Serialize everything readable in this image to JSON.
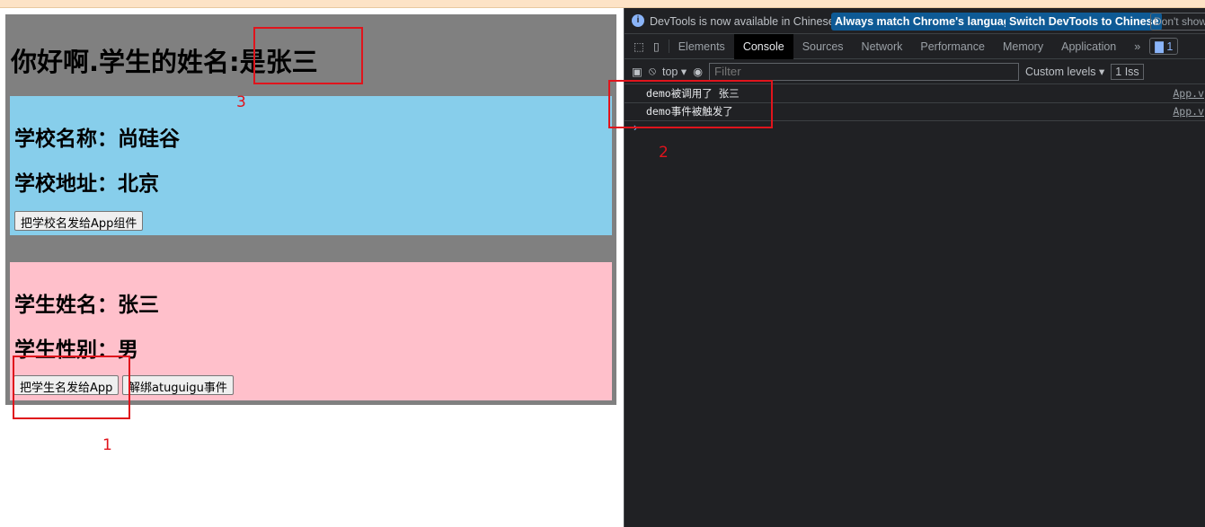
{
  "app": {
    "title": "你好啊.学生的姓名:是张三"
  },
  "school": {
    "name": "学校名称：尚硅谷",
    "address": "学校地址：北京",
    "button": "把学校名发给App组件"
  },
  "student": {
    "name": "学生姓名：张三",
    "gender": "学生性别：男",
    "send_button": "把学生名发给App",
    "unbind_button": "解绑atuguigu事件"
  },
  "annotations": [
    "1",
    "2",
    "3"
  ],
  "devtools": {
    "info": {
      "message": "DevTools is now available in Chinese!",
      "btn1": "Always match Chrome's language",
      "btn2": "Switch DevTools to Chinese",
      "btn3": "Don't show"
    },
    "tabs": [
      "Elements",
      "Console",
      "Sources",
      "Network",
      "Performance",
      "Memory",
      "Application"
    ],
    "more": "»",
    "issues_badge": "1",
    "toolbar": {
      "context": "top ▾",
      "filter_placeholder": "Filter",
      "levels": "Custom levels ▾",
      "issues": "1 Iss"
    },
    "console": [
      {
        "text": "demo被调用了 张三",
        "source": "App.v"
      },
      {
        "text": "demo事件被触发了",
        "source": "App.v"
      }
    ],
    "prompt": "›"
  },
  "colors": {
    "annotation": "#e0141c",
    "school_bg": "#87ceeb",
    "student_bg": "#ffc0cb",
    "app_bg": "#808080"
  }
}
